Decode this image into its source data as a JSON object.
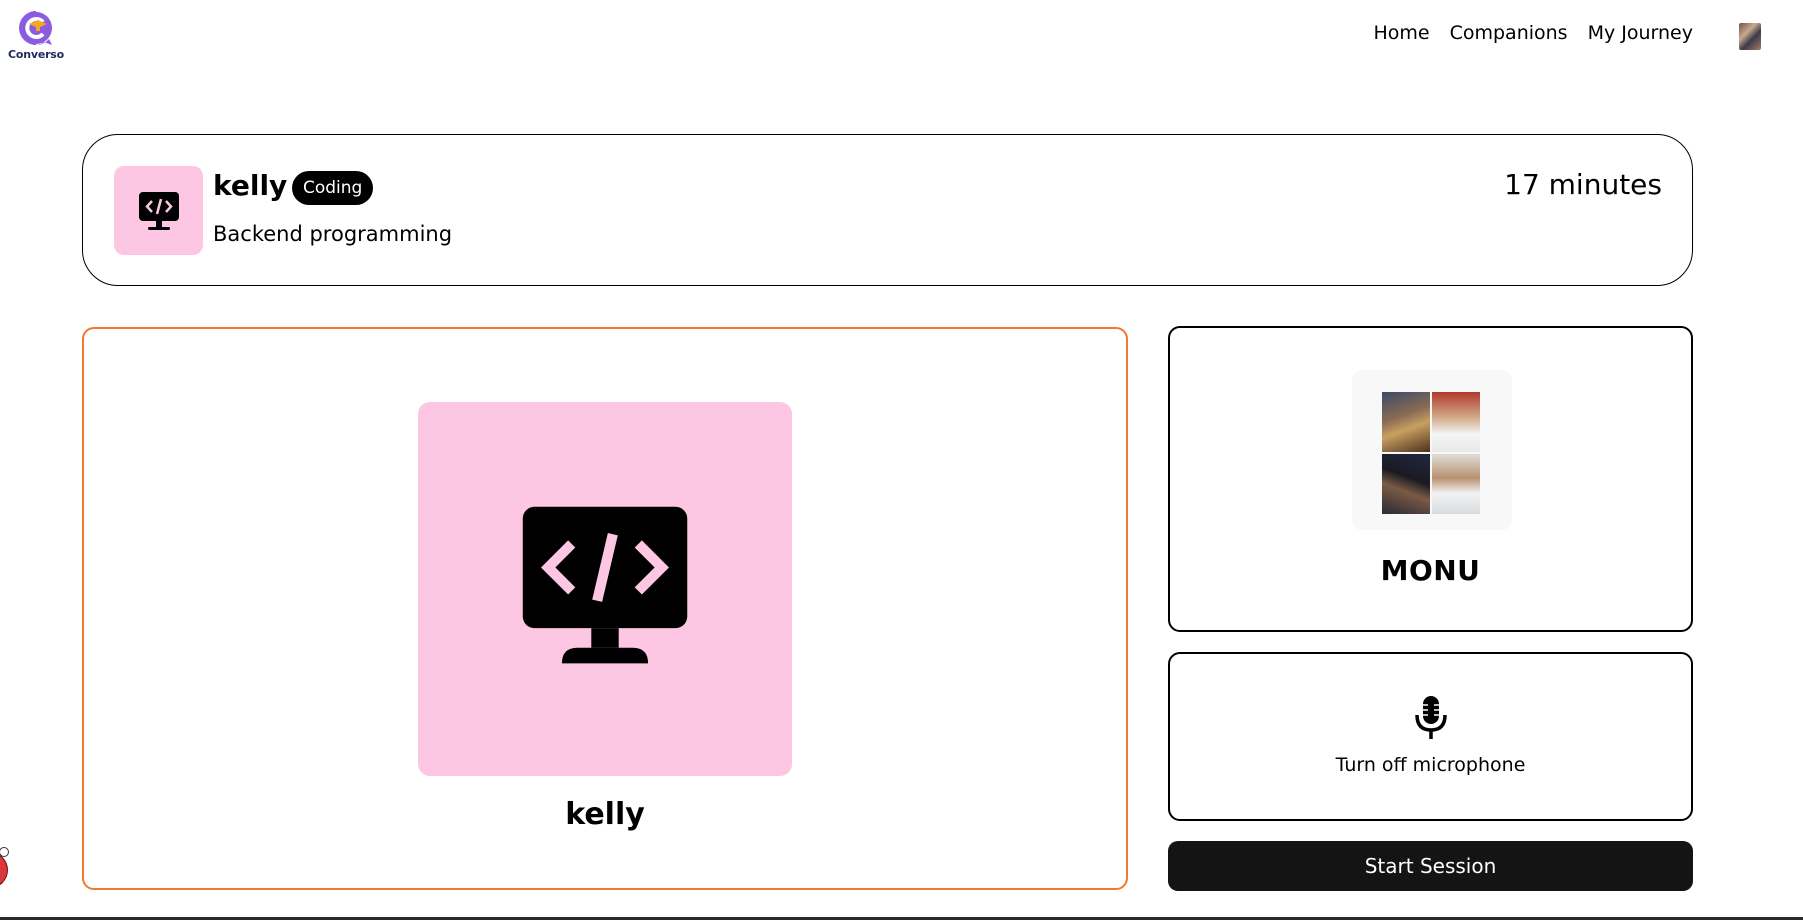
{
  "brand": {
    "name": "Converso",
    "colors": {
      "primary": "#7b4fd6",
      "accent": "#f5a623"
    }
  },
  "nav": {
    "items": [
      {
        "label": "Home"
      },
      {
        "label": "Companions"
      },
      {
        "label": "My Journey"
      }
    ],
    "avatar_icon": "user-avatar"
  },
  "companion": {
    "name": "kelly",
    "subject": "Coding",
    "topic": "Backend programming",
    "duration": "17 minutes",
    "icon": "code-monitor-icon",
    "avatar_bg": "#fdc7e4",
    "panel_border": "#f1782c"
  },
  "user": {
    "name": "MONU",
    "photo_icon": "user-photo-collage"
  },
  "controls": {
    "mic_label": "Turn off microphone",
    "mic_icon": "microphone-icon",
    "start_label": "Start Session",
    "start_bg": "#141414"
  }
}
